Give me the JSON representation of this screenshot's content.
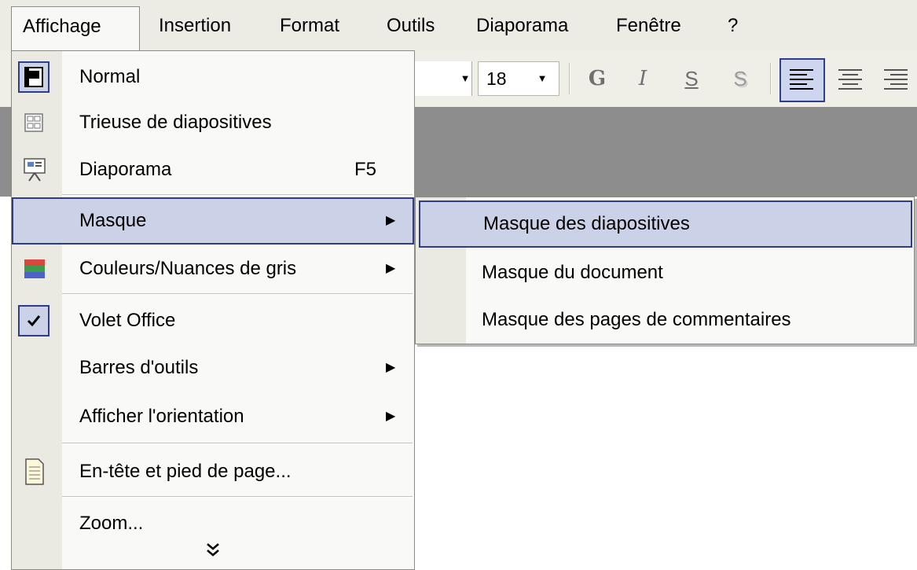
{
  "menubar": {
    "items": [
      {
        "label": "Affichage"
      },
      {
        "label": "Insertion"
      },
      {
        "label": "Format"
      },
      {
        "label": "Outils"
      },
      {
        "label": "Diaporama"
      },
      {
        "label": "Fenêtre"
      },
      {
        "label": "?"
      }
    ]
  },
  "toolbar": {
    "font_size": "18",
    "bold_label": "G",
    "italic_label": "I",
    "underline_label": "S",
    "shadow_label": "S"
  },
  "menu": {
    "items": [
      {
        "label": "Normal",
        "icon": "normal-view-icon"
      },
      {
        "label": "Trieuse de diapositives",
        "icon": "slide-sorter-icon"
      },
      {
        "label": "Diaporama",
        "shortcut": "F5",
        "icon": "slideshow-icon"
      },
      {
        "label": "Masque",
        "arrow": "▶"
      },
      {
        "label": "Couleurs/Nuances de gris",
        "arrow": "▶",
        "icon": "color-bars-icon"
      },
      {
        "label": "Volet Office",
        "icon": "checkmark-icon"
      },
      {
        "label": "Barres d'outils",
        "arrow": "▶"
      },
      {
        "label": "Afficher l'orientation",
        "arrow": "▶"
      },
      {
        "label": "En-tête et pied de page...",
        "icon": "document-icon"
      },
      {
        "label": "Zoom..."
      }
    ],
    "expand_glyph": "⌄⌄"
  },
  "submenu": {
    "items": [
      {
        "label": "Masque des diapositives"
      },
      {
        "label": "Masque du document"
      },
      {
        "label": "Masque des pages de commentaires"
      }
    ]
  },
  "colors": {
    "highlight_bg": "#cbd1e6",
    "highlight_border": "#2f3d87",
    "menu_bg": "#f9f9f7",
    "gutter_bg": "#ebeae2",
    "workspace_bg": "#8d8d8d"
  }
}
